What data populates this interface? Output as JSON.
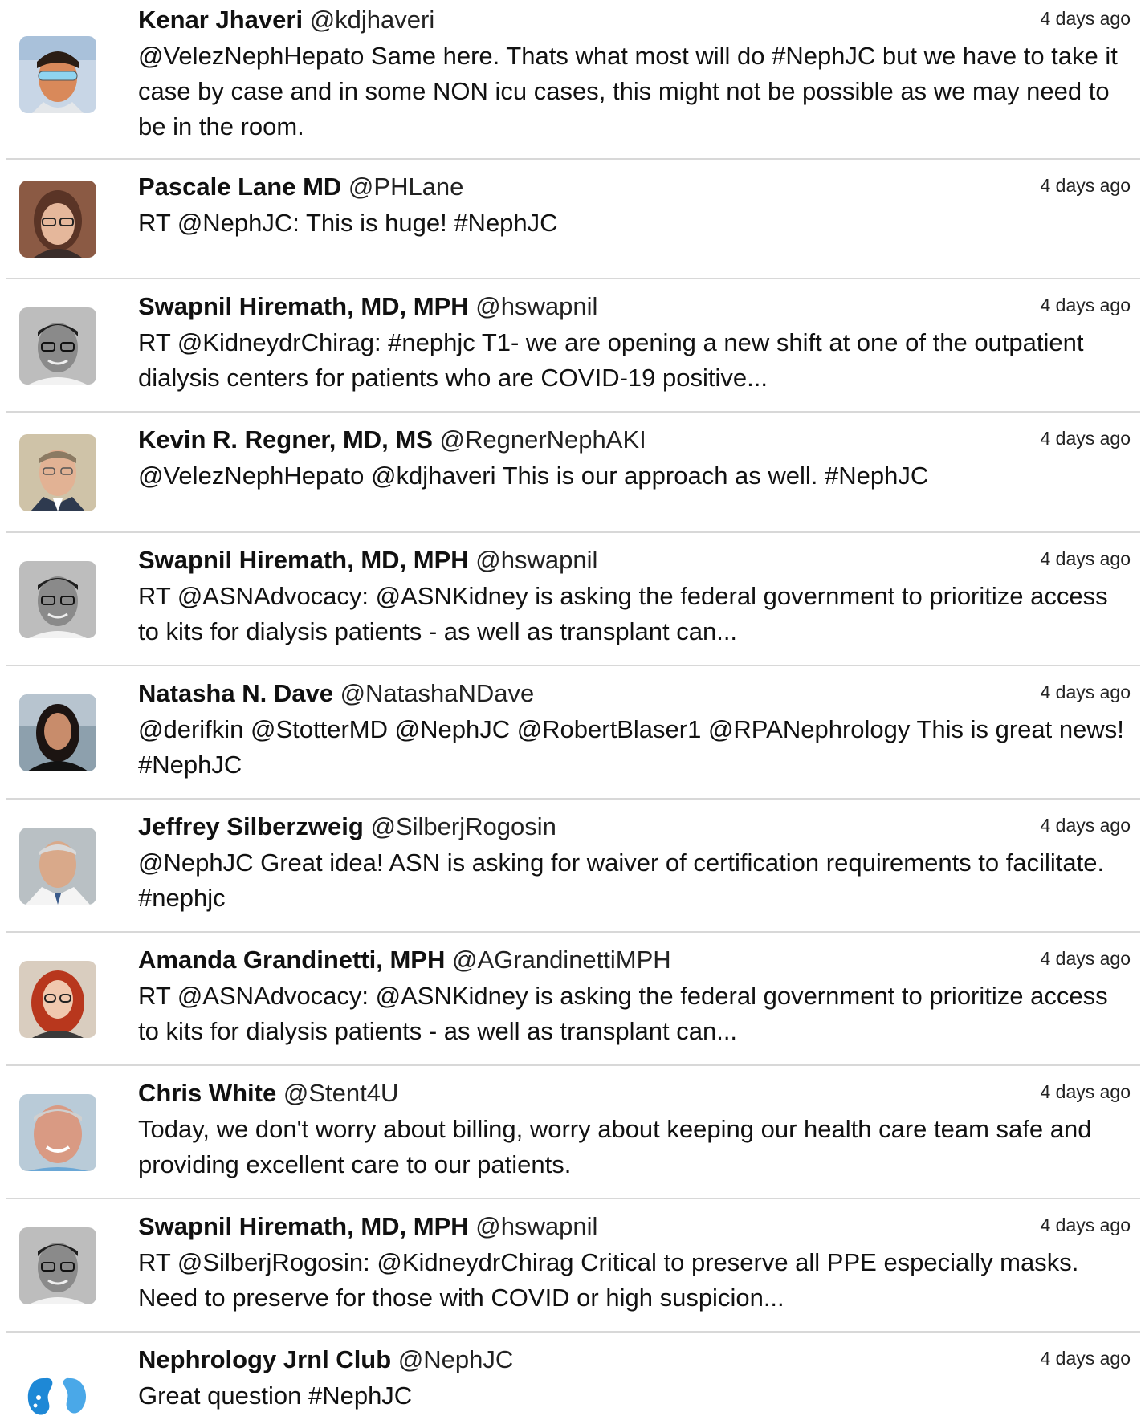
{
  "tweets": [
    {
      "name": "Kenar Jhaveri",
      "handle": "@kdjhaveri",
      "time": "4 days ago",
      "text": "@VelezNephHepato Same here. Thats what most will do #NephJC but we have to take it case by case and in some NON icu cases, this might not be possible as we may need to be in the room.",
      "avatar": "avatar-kenar-jhaveri"
    },
    {
      "name": "Pascale Lane MD",
      "handle": "@PHLane",
      "time": "4 days ago",
      "text": "RT @NephJC: This is huge! #NephJC",
      "avatar": "avatar-pascale-lane"
    },
    {
      "name": "Swapnil Hiremath, MD, MPH",
      "handle": "@hswapnil",
      "time": "4 days ago",
      "text": "RT @KidneydrChirag: #nephjc T1- we are opening a new shift at one of the outpatient dialysis centers for patients who are COVID-19 positive...",
      "avatar": "avatar-swapnil-hiremath"
    },
    {
      "name": "Kevin R. Regner, MD, MS",
      "handle": "@RegnerNephAKI",
      "time": "4 days ago",
      "text": "@VelezNephHepato @kdjhaveri This is our approach as well. #NephJC",
      "avatar": "avatar-kevin-regner"
    },
    {
      "name": "Swapnil Hiremath, MD, MPH",
      "handle": "@hswapnil",
      "time": "4 days ago",
      "text": "RT @ASNAdvocacy: @ASNKidney is asking the federal government to prioritize access to kits for dialysis patients - as well as transplant can...",
      "avatar": "avatar-swapnil-hiremath"
    },
    {
      "name": "Natasha N. Dave",
      "handle": "@NatashaNDave",
      "time": "4 days ago",
      "text": "@derifkin @StotterMD @NephJC @RobertBlaser1 @RPANephrology This is great news! #NephJC",
      "avatar": "avatar-natasha-dave"
    },
    {
      "name": "Jeffrey Silberzweig",
      "handle": "@SilberjRogosin",
      "time": "4 days ago",
      "text": "@NephJC Great idea! ASN is asking for waiver of certification requirements to facilitate. #nephjc",
      "avatar": "avatar-jeffrey-silberzweig"
    },
    {
      "name": "Amanda Grandinetti, MPH",
      "handle": "@AGrandinettiMPH",
      "time": "4 days ago",
      "text": "RT @ASNAdvocacy: @ASNKidney is asking the federal government to prioritize access to kits for dialysis patients - as well as transplant can...",
      "avatar": "avatar-amanda-grandinetti"
    },
    {
      "name": "Chris White",
      "handle": "@Stent4U",
      "time": "4 days ago",
      "text": "Today, we don't worry about billing, worry about keeping our health care team safe and providing excellent care to our patients.",
      "avatar": "avatar-chris-white"
    },
    {
      "name": "Swapnil Hiremath, MD, MPH",
      "handle": "@hswapnil",
      "time": "4 days ago",
      "text": "RT @SilberjRogosin: @KidneydrChirag Critical to preserve all PPE especially masks. Need to preserve for those with COVID or high suspicion...",
      "avatar": "avatar-swapnil-hiremath"
    },
    {
      "name": "Nephrology Jrnl Club",
      "handle": "@NephJC",
      "time": "4 days ago",
      "text": "Great question #NephJC",
      "avatar": "nephjc-kidney-logo"
    }
  ]
}
